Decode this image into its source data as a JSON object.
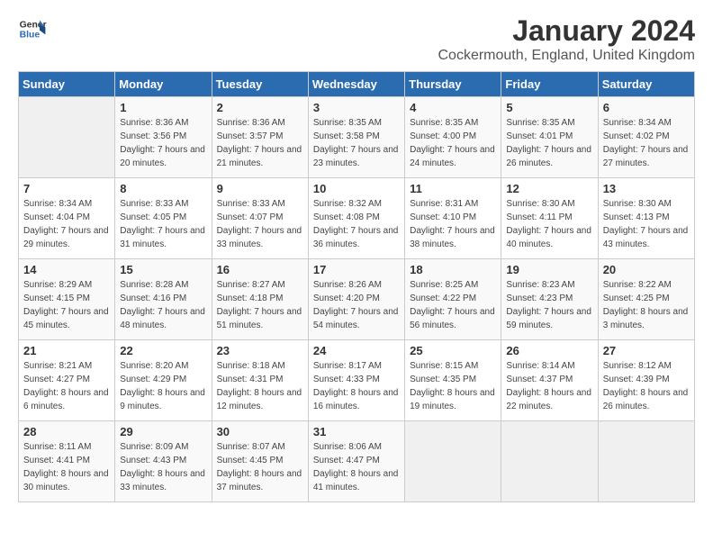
{
  "logo": {
    "text_general": "General",
    "text_blue": "Blue"
  },
  "header": {
    "month": "January 2024",
    "location": "Cockermouth, England, United Kingdom"
  },
  "days_of_week": [
    "Sunday",
    "Monday",
    "Tuesday",
    "Wednesday",
    "Thursday",
    "Friday",
    "Saturday"
  ],
  "weeks": [
    [
      {
        "day": "",
        "sunrise": "",
        "sunset": "",
        "daylight": ""
      },
      {
        "day": "1",
        "sunrise": "Sunrise: 8:36 AM",
        "sunset": "Sunset: 3:56 PM",
        "daylight": "Daylight: 7 hours and 20 minutes."
      },
      {
        "day": "2",
        "sunrise": "Sunrise: 8:36 AM",
        "sunset": "Sunset: 3:57 PM",
        "daylight": "Daylight: 7 hours and 21 minutes."
      },
      {
        "day": "3",
        "sunrise": "Sunrise: 8:35 AM",
        "sunset": "Sunset: 3:58 PM",
        "daylight": "Daylight: 7 hours and 23 minutes."
      },
      {
        "day": "4",
        "sunrise": "Sunrise: 8:35 AM",
        "sunset": "Sunset: 4:00 PM",
        "daylight": "Daylight: 7 hours and 24 minutes."
      },
      {
        "day": "5",
        "sunrise": "Sunrise: 8:35 AM",
        "sunset": "Sunset: 4:01 PM",
        "daylight": "Daylight: 7 hours and 26 minutes."
      },
      {
        "day": "6",
        "sunrise": "Sunrise: 8:34 AM",
        "sunset": "Sunset: 4:02 PM",
        "daylight": "Daylight: 7 hours and 27 minutes."
      }
    ],
    [
      {
        "day": "7",
        "sunrise": "Sunrise: 8:34 AM",
        "sunset": "Sunset: 4:04 PM",
        "daylight": "Daylight: 7 hours and 29 minutes."
      },
      {
        "day": "8",
        "sunrise": "Sunrise: 8:33 AM",
        "sunset": "Sunset: 4:05 PM",
        "daylight": "Daylight: 7 hours and 31 minutes."
      },
      {
        "day": "9",
        "sunrise": "Sunrise: 8:33 AM",
        "sunset": "Sunset: 4:07 PM",
        "daylight": "Daylight: 7 hours and 33 minutes."
      },
      {
        "day": "10",
        "sunrise": "Sunrise: 8:32 AM",
        "sunset": "Sunset: 4:08 PM",
        "daylight": "Daylight: 7 hours and 36 minutes."
      },
      {
        "day": "11",
        "sunrise": "Sunrise: 8:31 AM",
        "sunset": "Sunset: 4:10 PM",
        "daylight": "Daylight: 7 hours and 38 minutes."
      },
      {
        "day": "12",
        "sunrise": "Sunrise: 8:30 AM",
        "sunset": "Sunset: 4:11 PM",
        "daylight": "Daylight: 7 hours and 40 minutes."
      },
      {
        "day": "13",
        "sunrise": "Sunrise: 8:30 AM",
        "sunset": "Sunset: 4:13 PM",
        "daylight": "Daylight: 7 hours and 43 minutes."
      }
    ],
    [
      {
        "day": "14",
        "sunrise": "Sunrise: 8:29 AM",
        "sunset": "Sunset: 4:15 PM",
        "daylight": "Daylight: 7 hours and 45 minutes."
      },
      {
        "day": "15",
        "sunrise": "Sunrise: 8:28 AM",
        "sunset": "Sunset: 4:16 PM",
        "daylight": "Daylight: 7 hours and 48 minutes."
      },
      {
        "day": "16",
        "sunrise": "Sunrise: 8:27 AM",
        "sunset": "Sunset: 4:18 PM",
        "daylight": "Daylight: 7 hours and 51 minutes."
      },
      {
        "day": "17",
        "sunrise": "Sunrise: 8:26 AM",
        "sunset": "Sunset: 4:20 PM",
        "daylight": "Daylight: 7 hours and 54 minutes."
      },
      {
        "day": "18",
        "sunrise": "Sunrise: 8:25 AM",
        "sunset": "Sunset: 4:22 PM",
        "daylight": "Daylight: 7 hours and 56 minutes."
      },
      {
        "day": "19",
        "sunrise": "Sunrise: 8:23 AM",
        "sunset": "Sunset: 4:23 PM",
        "daylight": "Daylight: 7 hours and 59 minutes."
      },
      {
        "day": "20",
        "sunrise": "Sunrise: 8:22 AM",
        "sunset": "Sunset: 4:25 PM",
        "daylight": "Daylight: 8 hours and 3 minutes."
      }
    ],
    [
      {
        "day": "21",
        "sunrise": "Sunrise: 8:21 AM",
        "sunset": "Sunset: 4:27 PM",
        "daylight": "Daylight: 8 hours and 6 minutes."
      },
      {
        "day": "22",
        "sunrise": "Sunrise: 8:20 AM",
        "sunset": "Sunset: 4:29 PM",
        "daylight": "Daylight: 8 hours and 9 minutes."
      },
      {
        "day": "23",
        "sunrise": "Sunrise: 8:18 AM",
        "sunset": "Sunset: 4:31 PM",
        "daylight": "Daylight: 8 hours and 12 minutes."
      },
      {
        "day": "24",
        "sunrise": "Sunrise: 8:17 AM",
        "sunset": "Sunset: 4:33 PM",
        "daylight": "Daylight: 8 hours and 16 minutes."
      },
      {
        "day": "25",
        "sunrise": "Sunrise: 8:15 AM",
        "sunset": "Sunset: 4:35 PM",
        "daylight": "Daylight: 8 hours and 19 minutes."
      },
      {
        "day": "26",
        "sunrise": "Sunrise: 8:14 AM",
        "sunset": "Sunset: 4:37 PM",
        "daylight": "Daylight: 8 hours and 22 minutes."
      },
      {
        "day": "27",
        "sunrise": "Sunrise: 8:12 AM",
        "sunset": "Sunset: 4:39 PM",
        "daylight": "Daylight: 8 hours and 26 minutes."
      }
    ],
    [
      {
        "day": "28",
        "sunrise": "Sunrise: 8:11 AM",
        "sunset": "Sunset: 4:41 PM",
        "daylight": "Daylight: 8 hours and 30 minutes."
      },
      {
        "day": "29",
        "sunrise": "Sunrise: 8:09 AM",
        "sunset": "Sunset: 4:43 PM",
        "daylight": "Daylight: 8 hours and 33 minutes."
      },
      {
        "day": "30",
        "sunrise": "Sunrise: 8:07 AM",
        "sunset": "Sunset: 4:45 PM",
        "daylight": "Daylight: 8 hours and 37 minutes."
      },
      {
        "day": "31",
        "sunrise": "Sunrise: 8:06 AM",
        "sunset": "Sunset: 4:47 PM",
        "daylight": "Daylight: 8 hours and 41 minutes."
      },
      {
        "day": "",
        "sunrise": "",
        "sunset": "",
        "daylight": ""
      },
      {
        "day": "",
        "sunrise": "",
        "sunset": "",
        "daylight": ""
      },
      {
        "day": "",
        "sunrise": "",
        "sunset": "",
        "daylight": ""
      }
    ]
  ]
}
